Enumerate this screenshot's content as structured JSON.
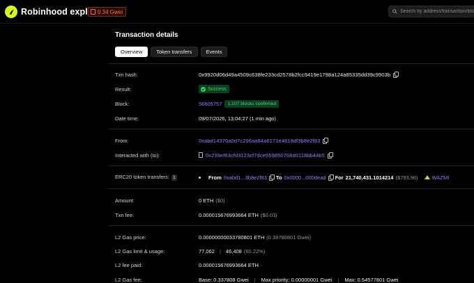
{
  "header": {
    "brand": "Robinhood explorer",
    "gas": "0.34 Gwei",
    "search_placeholder": "Search by address/transaction/block/t..."
  },
  "page": {
    "title": "Transaction details",
    "tabs": [
      {
        "label": "Overview",
        "active": true
      },
      {
        "label": "Token transfers",
        "active": false
      },
      {
        "label": "Events",
        "active": false
      }
    ]
  },
  "details": {
    "txn_hash": {
      "label": "Txn hash:",
      "value": "0x9920d06d49a4509c638fe233cd2578b2fcc9419e1798a124a85335dd39c9903b"
    },
    "result": {
      "label": "Result:",
      "value": "Success"
    },
    "block": {
      "label": "Block:",
      "value": "56605757",
      "confirmations": "1,107 blocks confirmed"
    },
    "date_time": {
      "label": "Date time:",
      "value": "09/07/2026, 13:04:27 (1 min ago)"
    },
    "from": {
      "label": "From:",
      "value": "0xabd14376a0d7c296aa84a6171e4818df3b8e2f83"
    },
    "interacted": {
      "label": "Interacted with (to):",
      "value": "0x239ef63cfd3123cf7dce559850768d0118bb44b5"
    },
    "erc20": {
      "label": "ERC20 token transfers:",
      "count": "1",
      "from_label": "From",
      "from_value": "0xabd1...3b8e2f83",
      "to_label": "To",
      "to_value": "0x0000...000dead",
      "for_label": "For",
      "amount": "21,740,431.1014214",
      "usd": "($793.96)",
      "token": "WAZMI"
    },
    "amount": {
      "label": "Amount:",
      "value": "0 ETH",
      "usd": "($0)"
    },
    "txn_fee": {
      "label": "Txn fee:",
      "value": "0.000015676993664 ETH",
      "usd": "($0.03)"
    },
    "gas_price": {
      "label": "L2 Gas price:",
      "value": "0.00000000033780801 ETH",
      "sub": "(0.33780801 Gwei)"
    },
    "gas_limit": {
      "label": "L2 Gas limit & usage:",
      "limit": "77,062",
      "usage": "46,408",
      "pct": "(60.22%)"
    },
    "fee_paid": {
      "label": "L2 fee paid:",
      "value": "0.000015676993664 ETH"
    },
    "gas_fee": {
      "label": "L2 Gas fee:",
      "base": "Base: 0.337808 Gwei",
      "max_priority": "Max priority: 0.00000001 Gwei",
      "max": "Max: 0.54577801 Gwei"
    }
  }
}
